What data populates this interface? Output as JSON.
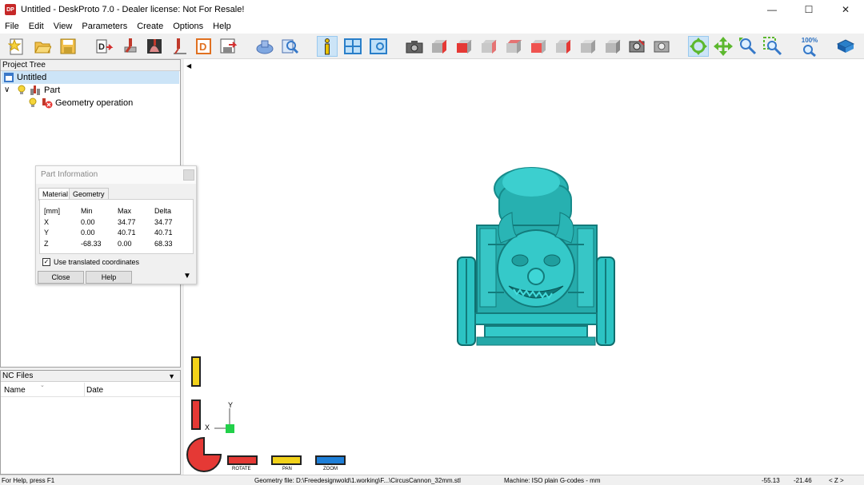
{
  "window": {
    "app_icon": "DP",
    "title": "Untitled - DeskProto 7.0 - Dealer license: Not For Resale!",
    "controls": [
      "minimize-icon",
      "maximize-icon",
      "close-icon"
    ]
  },
  "menu": [
    "File",
    "Edit",
    "View",
    "Parameters",
    "Create",
    "Options",
    "Help"
  ],
  "toolbar": {
    "zoom_label": "100%",
    "icons": [
      "new-project-icon",
      "open-project-icon",
      "save-project-icon",
      "open-geometry-icon",
      "part-parameters-icon",
      "operation-parameters-icon",
      "toolpath-icon",
      "draw-2d-icon",
      "save-nc-icon",
      "simulation-icon",
      "preview-icon",
      "info-icon",
      "layout-icon",
      "window-icon",
      "camera-icon",
      "cube-views-icon",
      "zoom-fit-icon",
      "rotate-icon",
      "pan-icon",
      "zoom-icon",
      "zoom-window-icon",
      "zoom-100-icon",
      "book-icon"
    ]
  },
  "project_tree": {
    "header": "Project Tree",
    "root": "Untitled",
    "part": "Part",
    "operation": "Geometry operation"
  },
  "part_info": {
    "title": "Part Information",
    "tabs": [
      "Material",
      "Geometry"
    ],
    "columns": [
      "[mm]",
      "Min",
      "Max",
      "Delta"
    ],
    "rows": [
      [
        "X",
        "0.00",
        "34.77",
        "34.77"
      ],
      [
        "Y",
        "0.00",
        "40.71",
        "40.71"
      ],
      [
        "Z",
        "-68.33",
        "0.00",
        "68.33"
      ]
    ],
    "checkbox_label": "Use translated coordinates",
    "checkbox_checked": true,
    "close_label": "Close",
    "help_label": "Help"
  },
  "nc_files": {
    "header": "NC Files",
    "columns": [
      "Name",
      "Date"
    ]
  },
  "viewport": {
    "axis_y": "Y",
    "axis_x": "X",
    "model_color": "#2cc3c3",
    "mode_buttons": [
      "ROTATE",
      "PAN",
      "ZOOM"
    ]
  },
  "status": {
    "help": "For Help, press F1",
    "geometry": "Geometry file: D:\\Freedesignwold\\1.working\\F...\\CircusCannon_32mm.stl",
    "machine": "Machine: ISO plain G-codes - mm",
    "coord_x": "-55.13",
    "coord_y": "-21.46",
    "axis": "< Z >"
  }
}
